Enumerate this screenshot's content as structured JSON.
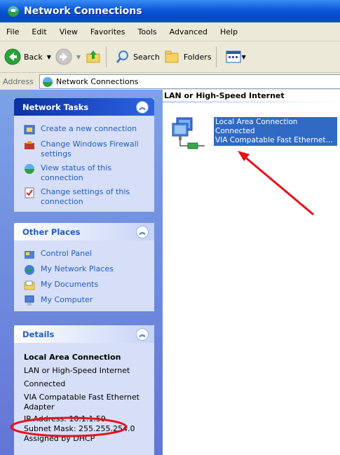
{
  "window": {
    "title": "Network Connections"
  },
  "menu": [
    "File",
    "Edit",
    "View",
    "Favorites",
    "Tools",
    "Advanced",
    "Help"
  ],
  "toolbar": {
    "back": "Back",
    "search": "Search",
    "folders": "Folders"
  },
  "address": {
    "label": "Address",
    "value": "Network Connections"
  },
  "network_tasks": {
    "title": "Network Tasks",
    "items": [
      {
        "label": "Create a new connection"
      },
      {
        "label": "Change Windows Firewall settings"
      },
      {
        "label": "View status of this connection"
      },
      {
        "label": "Change settings of this connection"
      }
    ]
  },
  "other_places": {
    "title": "Other Places",
    "items": [
      {
        "label": "Control Panel"
      },
      {
        "label": "My Network Places"
      },
      {
        "label": "My Documents"
      },
      {
        "label": "My Computer"
      }
    ]
  },
  "details": {
    "title": "Details",
    "name": "Local Area Connection",
    "type": "LAN or High-Speed Internet",
    "status": "Connected",
    "adapter": "VIA Compatable Fast Ethernet Adapter",
    "ip": "IP Address: 10.1.1.59",
    "subnet": "Subnet Mask: 255.255.254.0",
    "assigned": "Assigned by DHCP"
  },
  "group": {
    "title": "LAN or High-Speed Internet"
  },
  "connection": {
    "name": "Local Area Connection",
    "status": "Connected",
    "adapter": "VIA Compatable Fast Ethernet..."
  },
  "colors": {
    "annotation": "#e8101a",
    "selection": "#316ac5"
  }
}
